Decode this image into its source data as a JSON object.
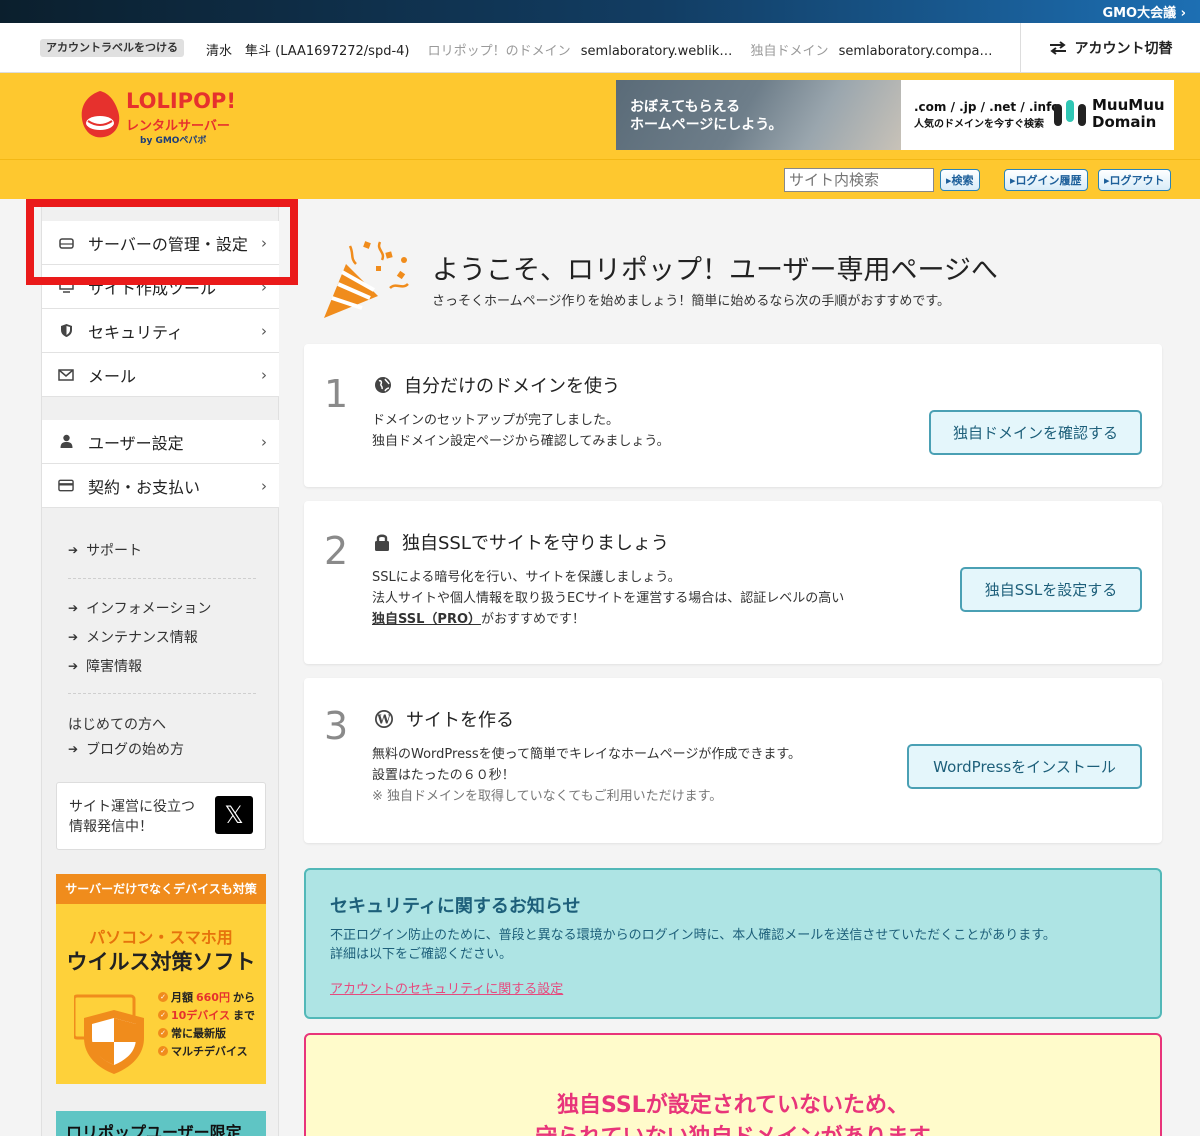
{
  "gmo_bar": {
    "text": "GMO大会議 ›"
  },
  "account": {
    "label_button": "アカウントラベルをつける",
    "user": "清水　隼斗 (LAA1697272/spd-4)",
    "lolipop_domain_label": "ロリポップ！のドメイン",
    "lolipop_domain_value": "semlaboratory.weblik…",
    "own_domain_label": "独自ドメイン",
    "own_domain_value": "semlaboratory.compa…",
    "switch_label": "アカウント切替"
  },
  "header": {
    "logo_line1": "LOLIPOP!",
    "logo_line2": "レンタルサーバー",
    "logo_line3": "by GMOペパボ",
    "banner_photo_text_1": "おぼえてもらえる",
    "banner_photo_text_2": "ホームページにしよう。",
    "banner_domains": ".com / .jp / .net / .info",
    "banner_domains_sub": "人気のドメインを今すぐ検索",
    "banner_brand_1": "MuuMuu",
    "banner_brand_2": "Domain"
  },
  "search": {
    "placeholder": "サイト内検索",
    "search_button": "▸検索",
    "history_button": "▸ログイン履歴",
    "logout_button": "▸ログアウト"
  },
  "sidebar": {
    "items": [
      {
        "label": "サーバーの管理・設定",
        "icon": "server-icon"
      },
      {
        "label": "サイト作成ツール",
        "icon": "monitor-icon"
      },
      {
        "label": "セキュリティ",
        "icon": "shield-icon"
      },
      {
        "label": "メール",
        "icon": "mail-icon"
      },
      {
        "label": "ユーザー設定",
        "icon": "user-icon"
      },
      {
        "label": "契約・お支払い",
        "icon": "credit-card-icon"
      }
    ],
    "links": [
      "サポート",
      "インフォメーション",
      "メンテナンス情報",
      "障害情報"
    ],
    "beginner_heading": "はじめての方へ",
    "blog_link": "ブログの始め方",
    "x_box_line1": "サイト運営に役立つ",
    "x_box_line2": "情報発信中！",
    "ad": {
      "top": "サーバーだけでなくデバイスも対策",
      "line1": "パソコン・スマホ用",
      "line2": "ウイルス対策ソフト",
      "feat1_pre": "月額",
      "feat1_hl": "660円",
      "feat1_post": "から",
      "feat2_hl": "10デバイス",
      "feat2_post": "まで",
      "feat3": "常に最新版",
      "feat4": "マルチデバイス"
    },
    "ad2_text": "ロリポップユーザー限定"
  },
  "welcome": {
    "title": "ようこそ、ロリポップ！ユーザー専用ページへ",
    "subtitle": "さっそくホームページ作りを始めましょう！簡単に始めるなら次の手順がおすすめです。"
  },
  "steps": [
    {
      "num": "1",
      "title": "自分だけのドメインを使う",
      "icon": "globe-icon",
      "body1": "ドメインのセットアップが完了しました。",
      "body2": "独自ドメイン設定ページから確認してみましょう。",
      "button": "独自ドメインを確認する"
    },
    {
      "num": "2",
      "title": "独自SSLでサイトを守りましょう",
      "icon": "lock-icon",
      "body1": "SSLによる暗号化を行い、サイトを保護しましょう。",
      "body2": "法人サイトや個人情報を取り扱うECサイトを運営する場合は、認証レベルの高い",
      "body3_link": "独自SSL（PRO）",
      "body3_post": "がおすすめです！",
      "button": "独自SSLを設定する"
    },
    {
      "num": "3",
      "title": "サイトを作る",
      "icon": "wordpress-icon",
      "body1": "無料のWordPressを使って簡単でキレイなホームページが作成できます。",
      "body2": "設置はたったの６０秒！",
      "note": "※ 独自ドメインを取得していなくてもご利用いただけます。",
      "button": "WordPressをインストール"
    }
  ],
  "notice": {
    "title": "セキュリティに関するお知らせ",
    "body1": "不正ログイン防止のために、普段と異なる環境からのログイン時に、本人確認メールを送信させていただくことがあります。",
    "body2": "詳細は以下をご確認ください。",
    "link": "アカウントのセキュリティに関する設定"
  },
  "warning": {
    "line1": "独自SSLが設定されていないため、",
    "line2": "守られていない独自ドメインがあります"
  },
  "colors": {
    "header_yellow": "#fec82f",
    "brand_red": "#e6312d",
    "notice_bg": "#aee4e4",
    "warning_pink": "#e8347a"
  }
}
